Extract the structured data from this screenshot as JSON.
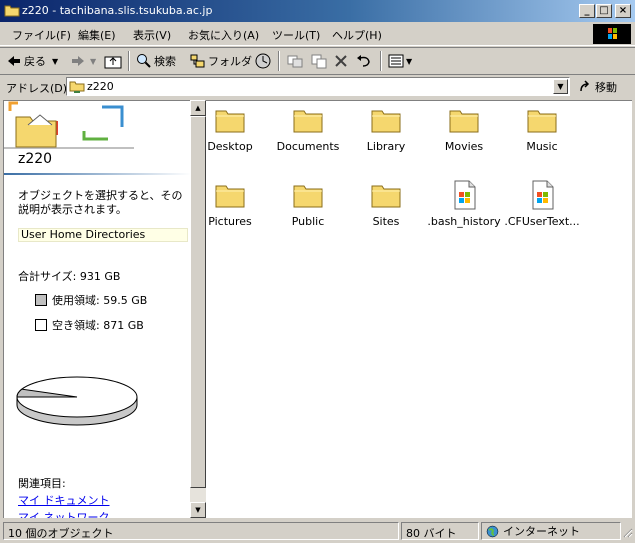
{
  "window": {
    "title": "z220 - tachibana.slis.tsukuba.ac.jp"
  },
  "title_buttons": {
    "minimize": "_",
    "maximize": "□",
    "close": "×"
  },
  "menu": [
    "ファイル(F)",
    "編集(E)",
    "表示(V)",
    "お気に入り(A)",
    "ツール(T)",
    "ヘルプ(H)"
  ],
  "toolbar": {
    "back": "戻る",
    "search": "検索",
    "folders": "フォルダ"
  },
  "address": {
    "label": "アドレス(D)",
    "value": "z220",
    "go": "移動"
  },
  "left_panel": {
    "folder_name": "z220",
    "description": "オブジェクトを選択すると、その説明が表示されます。",
    "info_box": "User Home Directories",
    "total_size": "合計サイズ: 931 GB",
    "used": "使用領域: 59.5 GB",
    "free": "空き領域: 871 GB",
    "related_label": "関連項目:",
    "links": [
      "マイ ドキュメント",
      "マイ ネットワーク"
    ]
  },
  "disk_usage": {
    "used_gb": 59.5,
    "free_gb": 871,
    "total_gb": 931
  },
  "files": [
    {
      "name": "Desktop",
      "type": "folder"
    },
    {
      "name": "Documents",
      "type": "folder"
    },
    {
      "name": "Library",
      "type": "folder"
    },
    {
      "name": "Movies",
      "type": "folder"
    },
    {
      "name": "Music",
      "type": "folder"
    },
    {
      "name": "Pictures",
      "type": "folder"
    },
    {
      "name": "Public",
      "type": "folder"
    },
    {
      "name": "Sites",
      "type": "folder"
    },
    {
      "name": ".bash_history",
      "type": "file"
    },
    {
      "name": ".CFUserText...",
      "type": "file"
    }
  ],
  "status": {
    "objects": "10 個のオブジェクト",
    "size": "80 バイト",
    "zone": "インターネット"
  },
  "colors": {
    "title_start": "#0a246a",
    "title_end": "#a6caf0",
    "folder": "#f5d76e",
    "link": "#0000ee"
  }
}
